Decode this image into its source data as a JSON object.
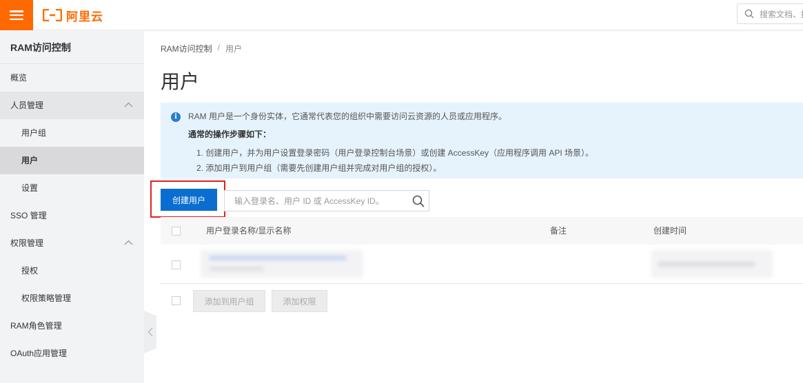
{
  "topbar": {
    "brand": "阿里云",
    "search_placeholder": "搜索文档、控",
    "accent_color": "#ff6a00"
  },
  "sidebar": {
    "title": "RAM访问控制",
    "items": [
      {
        "label": "概览"
      },
      {
        "label": "人员管理"
      },
      {
        "label": "用户组"
      },
      {
        "label": "用户"
      },
      {
        "label": "设置"
      },
      {
        "label": "SSO 管理"
      },
      {
        "label": "权限管理"
      },
      {
        "label": "授权"
      },
      {
        "label": "权限策略管理"
      },
      {
        "label": "RAM角色管理"
      },
      {
        "label": "OAuth应用管理"
      }
    ]
  },
  "breadcrumb": {
    "root": "RAM访问控制",
    "separator": "/",
    "current": "用户"
  },
  "page": {
    "title": "用户"
  },
  "info": {
    "line1": "RAM 用户是一个身份实体，它通常代表您的组织中需要访问云资源的人员或应用程序。",
    "heading": "通常的操作步骤如下：",
    "step1": "1. 创建用户，并为用户设置登录密码（用户登录控制台场景）或创建 AccessKey（应用程序调用 API 场景）。",
    "step2": "2. 添加用户到用户组（需要先创建用户组并完成对用户组的授权）。"
  },
  "toolbar": {
    "create_label": "创建用户",
    "search_placeholder": "输入登录名、用户 ID 或 AccessKey ID。",
    "primary_color": "#0a6ed1"
  },
  "table": {
    "columns": [
      "用户登录名称/显示名称",
      "备注",
      "创建时间"
    ]
  },
  "footer": {
    "add_to_group_label": "添加到用户组",
    "add_permission_label": "添加权限"
  }
}
